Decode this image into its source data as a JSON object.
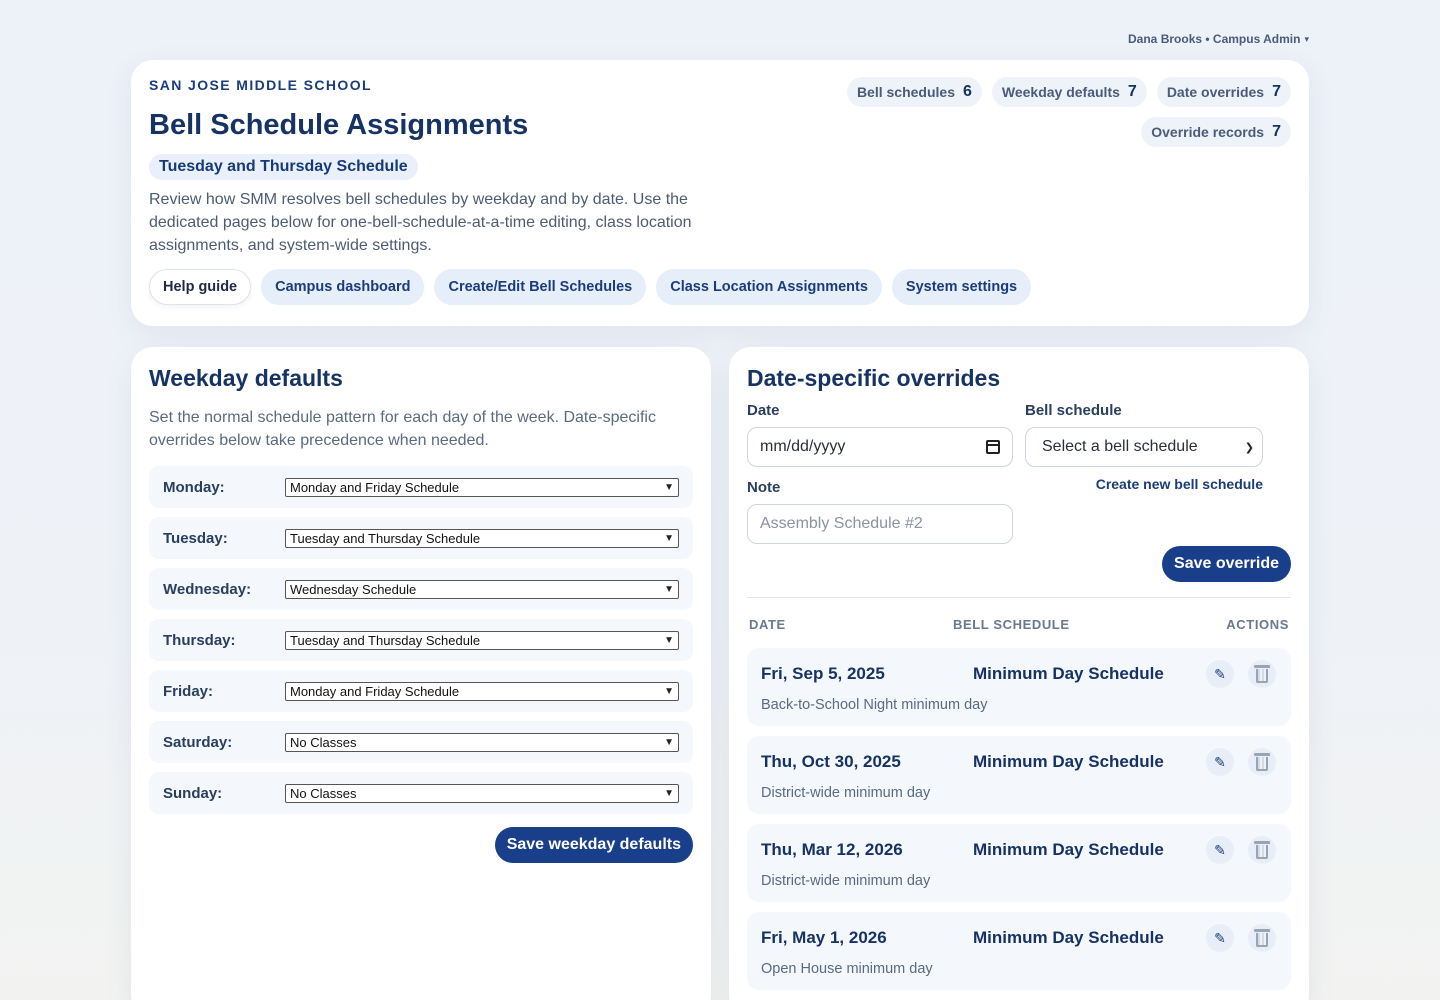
{
  "user_menu": {
    "label": "Dana Brooks • Campus Admin"
  },
  "header": {
    "school": "SAN JOSE MIDDLE SCHOOL",
    "title": "Bell Schedule Assignments",
    "today_schedule": "Tuesday and Thursday Schedule",
    "intro": "Review how SMM resolves bell schedules by weekday and by date. Use the dedicated pages below for one-bell-schedule-at-a-time editing, class location assignments, and system-wide settings.",
    "nav": {
      "help": "Help guide",
      "dashboard": "Campus dashboard",
      "edit_schedules": "Create/Edit Bell Schedules",
      "class_locations": "Class Location Assignments",
      "settings": "System settings"
    },
    "stats": [
      {
        "label": "Bell schedules",
        "value": "6"
      },
      {
        "label": "Weekday defaults",
        "value": "7"
      },
      {
        "label": "Date overrides",
        "value": "7"
      },
      {
        "label": "Override records",
        "value": "7"
      }
    ]
  },
  "weekday": {
    "title": "Weekday defaults",
    "description": "Set the normal schedule pattern for each day of the week. Date-specific overrides below take precedence when needed.",
    "days": [
      {
        "label": "Monday:",
        "value": "Monday and Friday Schedule"
      },
      {
        "label": "Tuesday:",
        "value": "Tuesday and Thursday Schedule"
      },
      {
        "label": "Wednesday:",
        "value": "Wednesday Schedule"
      },
      {
        "label": "Thursday:",
        "value": "Tuesday and Thursday Schedule"
      },
      {
        "label": "Friday:",
        "value": "Monday and Friday Schedule"
      },
      {
        "label": "Saturday:",
        "value": "No Classes"
      },
      {
        "label": "Sunday:",
        "value": "No Classes"
      }
    ],
    "save_label": "Save weekday defaults"
  },
  "overrides": {
    "title": "Date-specific overrides",
    "form": {
      "date_label": "Date",
      "date_placeholder": "mm/dd/yyyy",
      "schedule_label": "Bell schedule",
      "schedule_value": "Select a bell schedule",
      "create_link": "Create new bell schedule",
      "note_label": "Note",
      "note_placeholder": "Assembly Schedule #2",
      "save_label": "Save override"
    },
    "columns": {
      "date": "DATE",
      "schedule": "BELL SCHEDULE",
      "actions": "ACTIONS"
    },
    "rows": [
      {
        "date": "Fri, Sep 5, 2025",
        "schedule": "Minimum Day Schedule",
        "note": "Back-to-School Night minimum day"
      },
      {
        "date": "Thu, Oct 30, 2025",
        "schedule": "Minimum Day Schedule",
        "note": "District-wide minimum day"
      },
      {
        "date": "Thu, Mar 12, 2026",
        "schedule": "Minimum Day Schedule",
        "note": "District-wide minimum day"
      },
      {
        "date": "Fri, May 1, 2026",
        "schedule": "Minimum Day Schedule",
        "note": "Open House minimum day"
      }
    ],
    "icons": {
      "edit": "pencil-icon",
      "delete": "trash-icon"
    }
  },
  "colors": {
    "accent": "#1a3f8a",
    "title": "#163363",
    "chip_bg": "#e6eefa"
  }
}
